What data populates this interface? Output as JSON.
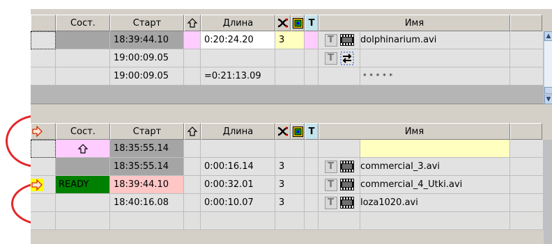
{
  "colors": {
    "window_bg": "#d4d0c8",
    "cell_bg": "#e2e2e2",
    "gray_cell": "#a5a5a5",
    "pink": "#ffccff",
    "yellow_light": "#ffffc0",
    "salmon": "#ffc6c6",
    "ready_green": "#008000",
    "circle_red": "#e4262a",
    "marker_yellow": "#ffff00"
  },
  "columns": {
    "status": "Сост.",
    "start": "Старт",
    "length": "Длина",
    "name": "Имя"
  },
  "top_pane": {
    "header_icons": [
      "arrow-up-icon",
      "shuffle-icon",
      "color-box-icon",
      "t-icon"
    ],
    "rows": [
      {
        "start": "18:39:44.10",
        "length": "0:20:24.20",
        "count": "3",
        "name": "dolphinarium.avi",
        "icons": [
          "t-icon",
          "film-icon"
        ]
      },
      {
        "start": "19:00:09.05",
        "length": "",
        "count": "",
        "name": "",
        "icons": [
          "t-icon",
          "swap-icon"
        ]
      },
      {
        "start": "19:00:09.05",
        "length": "=0:21:13.09",
        "count": "",
        "name": "* * * * *"
      }
    ]
  },
  "bottom_pane": {
    "header_icons": [
      "play-marker-icon",
      "arrow-up-icon",
      "shuffle-icon",
      "color-box-icon",
      "t-icon"
    ],
    "rows": [
      {
        "status": "",
        "start": "18:35:55.14",
        "length": "",
        "count": "",
        "name": ""
      },
      {
        "status": "",
        "start": "18:35:55.14",
        "length": "0:00:16.14",
        "count": "3",
        "name": "commercial_3.avi"
      },
      {
        "status": "READY",
        "start": "18:39:44.10",
        "length": "0:00:32.01",
        "count": "3",
        "name": "commercial_4_Utki.avi"
      },
      {
        "status": "",
        "start": "18:40:16.08",
        "length": "0:00:10.07",
        "count": "3",
        "name": "loza1020.avi"
      }
    ]
  }
}
